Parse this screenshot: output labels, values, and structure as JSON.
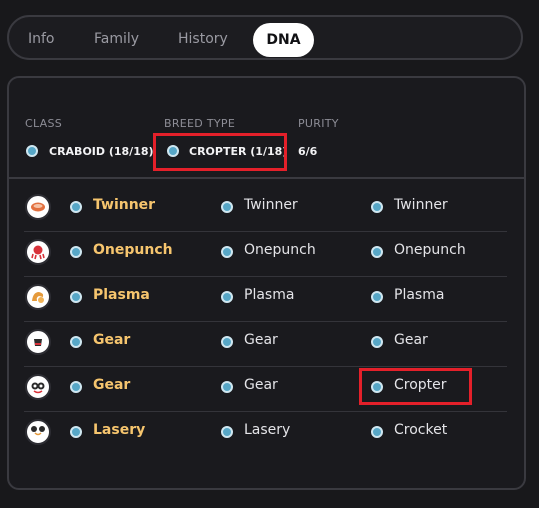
{
  "tabs": [
    {
      "label": "Info"
    },
    {
      "label": "Family"
    },
    {
      "label": "History"
    },
    {
      "label": "DNA",
      "active": true
    }
  ],
  "summary": {
    "class_label": "CLASS",
    "class_value": "CRABOID (18/18)",
    "breed_label": "BREED TYPE",
    "breed_value": "CROPTER (1/18)",
    "purity_label": "PURITY",
    "purity_value": "6/6"
  },
  "genes": [
    {
      "part": "mouth-shell",
      "primary": "Twinner",
      "secondary": "Twinner",
      "tertiary": "Twinner"
    },
    {
      "part": "octopus",
      "primary": "Onepunch",
      "secondary": "Onepunch",
      "tertiary": "Onepunch"
    },
    {
      "part": "claw",
      "primary": "Plasma",
      "secondary": "Plasma",
      "tertiary": "Plasma"
    },
    {
      "part": "cup",
      "primary": "Gear",
      "secondary": "Gear",
      "tertiary": "Gear"
    },
    {
      "part": "eyes",
      "primary": "Gear",
      "secondary": "Gear",
      "tertiary": "Cropter"
    },
    {
      "part": "antenna",
      "primary": "Lasery",
      "secondary": "Lasery",
      "tertiary": "Crocket"
    }
  ],
  "colors": {
    "gene_dot": "#57a7c7",
    "primary_text": "#f6c56e",
    "highlight": "#e4202a"
  }
}
